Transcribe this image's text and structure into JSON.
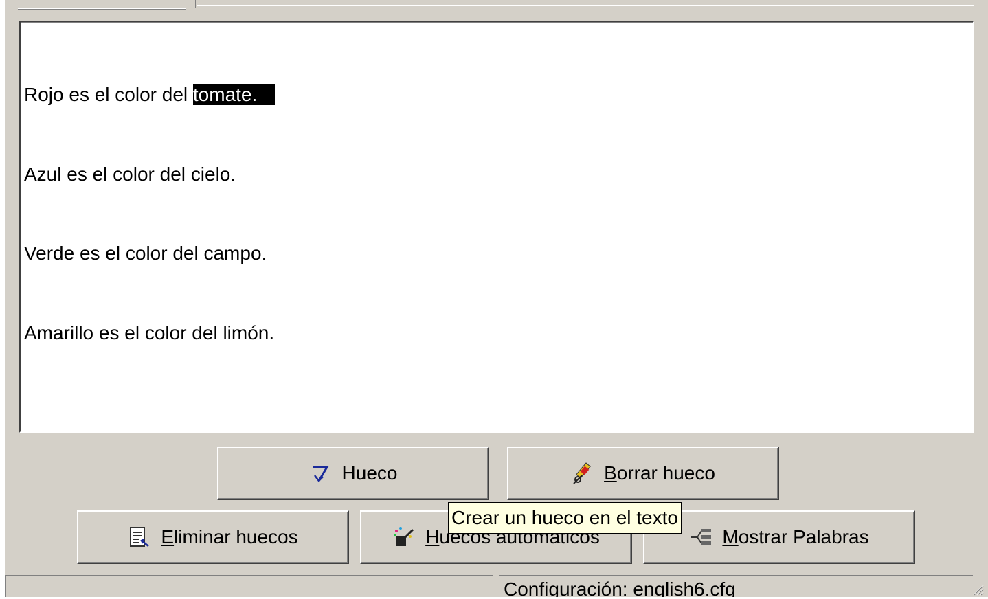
{
  "editor": {
    "lines": [
      {
        "before": "Rojo es el color del ",
        "selected": "tomate."
      },
      {
        "text": "Azul es el color del cielo."
      },
      {
        "text": "Verde es el color del campo."
      },
      {
        "text": "Amarillo es el color del limón."
      }
    ]
  },
  "buttons": {
    "hueco": {
      "label": "Hueco",
      "icon": "gap-arrow-icon"
    },
    "borrar": {
      "mnemonic": "B",
      "rest": "orrar hueco",
      "icon": "eraser-icon"
    },
    "eliminar": {
      "mnemonic": "E",
      "rest": "liminar huecos",
      "icon": "document-remove-icon"
    },
    "auto": {
      "mnemonic": "H",
      "rest": "uecos automáticos",
      "icon": "magic-wand-icon"
    },
    "mostrar": {
      "mnemonic": "M",
      "rest": "ostrar Palabras",
      "icon": "word-list-icon"
    }
  },
  "tooltip": {
    "text": "Crear un hueco en el texto"
  },
  "status": {
    "config": "Configuración: english6.cfg"
  },
  "colors": {
    "face": "#d4d0c8",
    "tooltip_bg": "#ffffe1",
    "selection": "#000000"
  }
}
